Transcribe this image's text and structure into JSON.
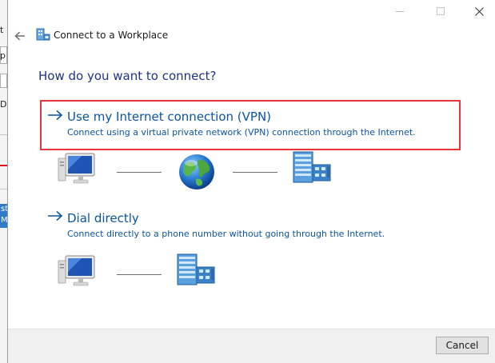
{
  "window": {
    "title": "Connect to a Workplace",
    "controls": {
      "minimize": "minimize-icon",
      "maximize": "maximize-icon",
      "close": "close-icon"
    }
  },
  "background_window": {
    "fragments": [
      "t",
      "p",
      "D",
      "st",
      "M"
    ]
  },
  "heading": "How do you want to connect?",
  "options": [
    {
      "title": "Use my Internet connection (VPN)",
      "description": "Connect using a virtual private network (VPN) connection through the Internet.",
      "diagram": [
        "computer-icon",
        "globe-icon",
        "building-icon"
      ]
    },
    {
      "title": "Dial directly",
      "description": "Connect directly to a phone number without going through the Internet.",
      "diagram": [
        "computer-icon",
        "building-icon"
      ]
    }
  ],
  "footer": {
    "cancel_label": "Cancel"
  },
  "colors": {
    "link": "#0b54a0",
    "heading": "#1e3287",
    "highlight": "#e8343c",
    "footer_bg": "#f0f0f0"
  }
}
